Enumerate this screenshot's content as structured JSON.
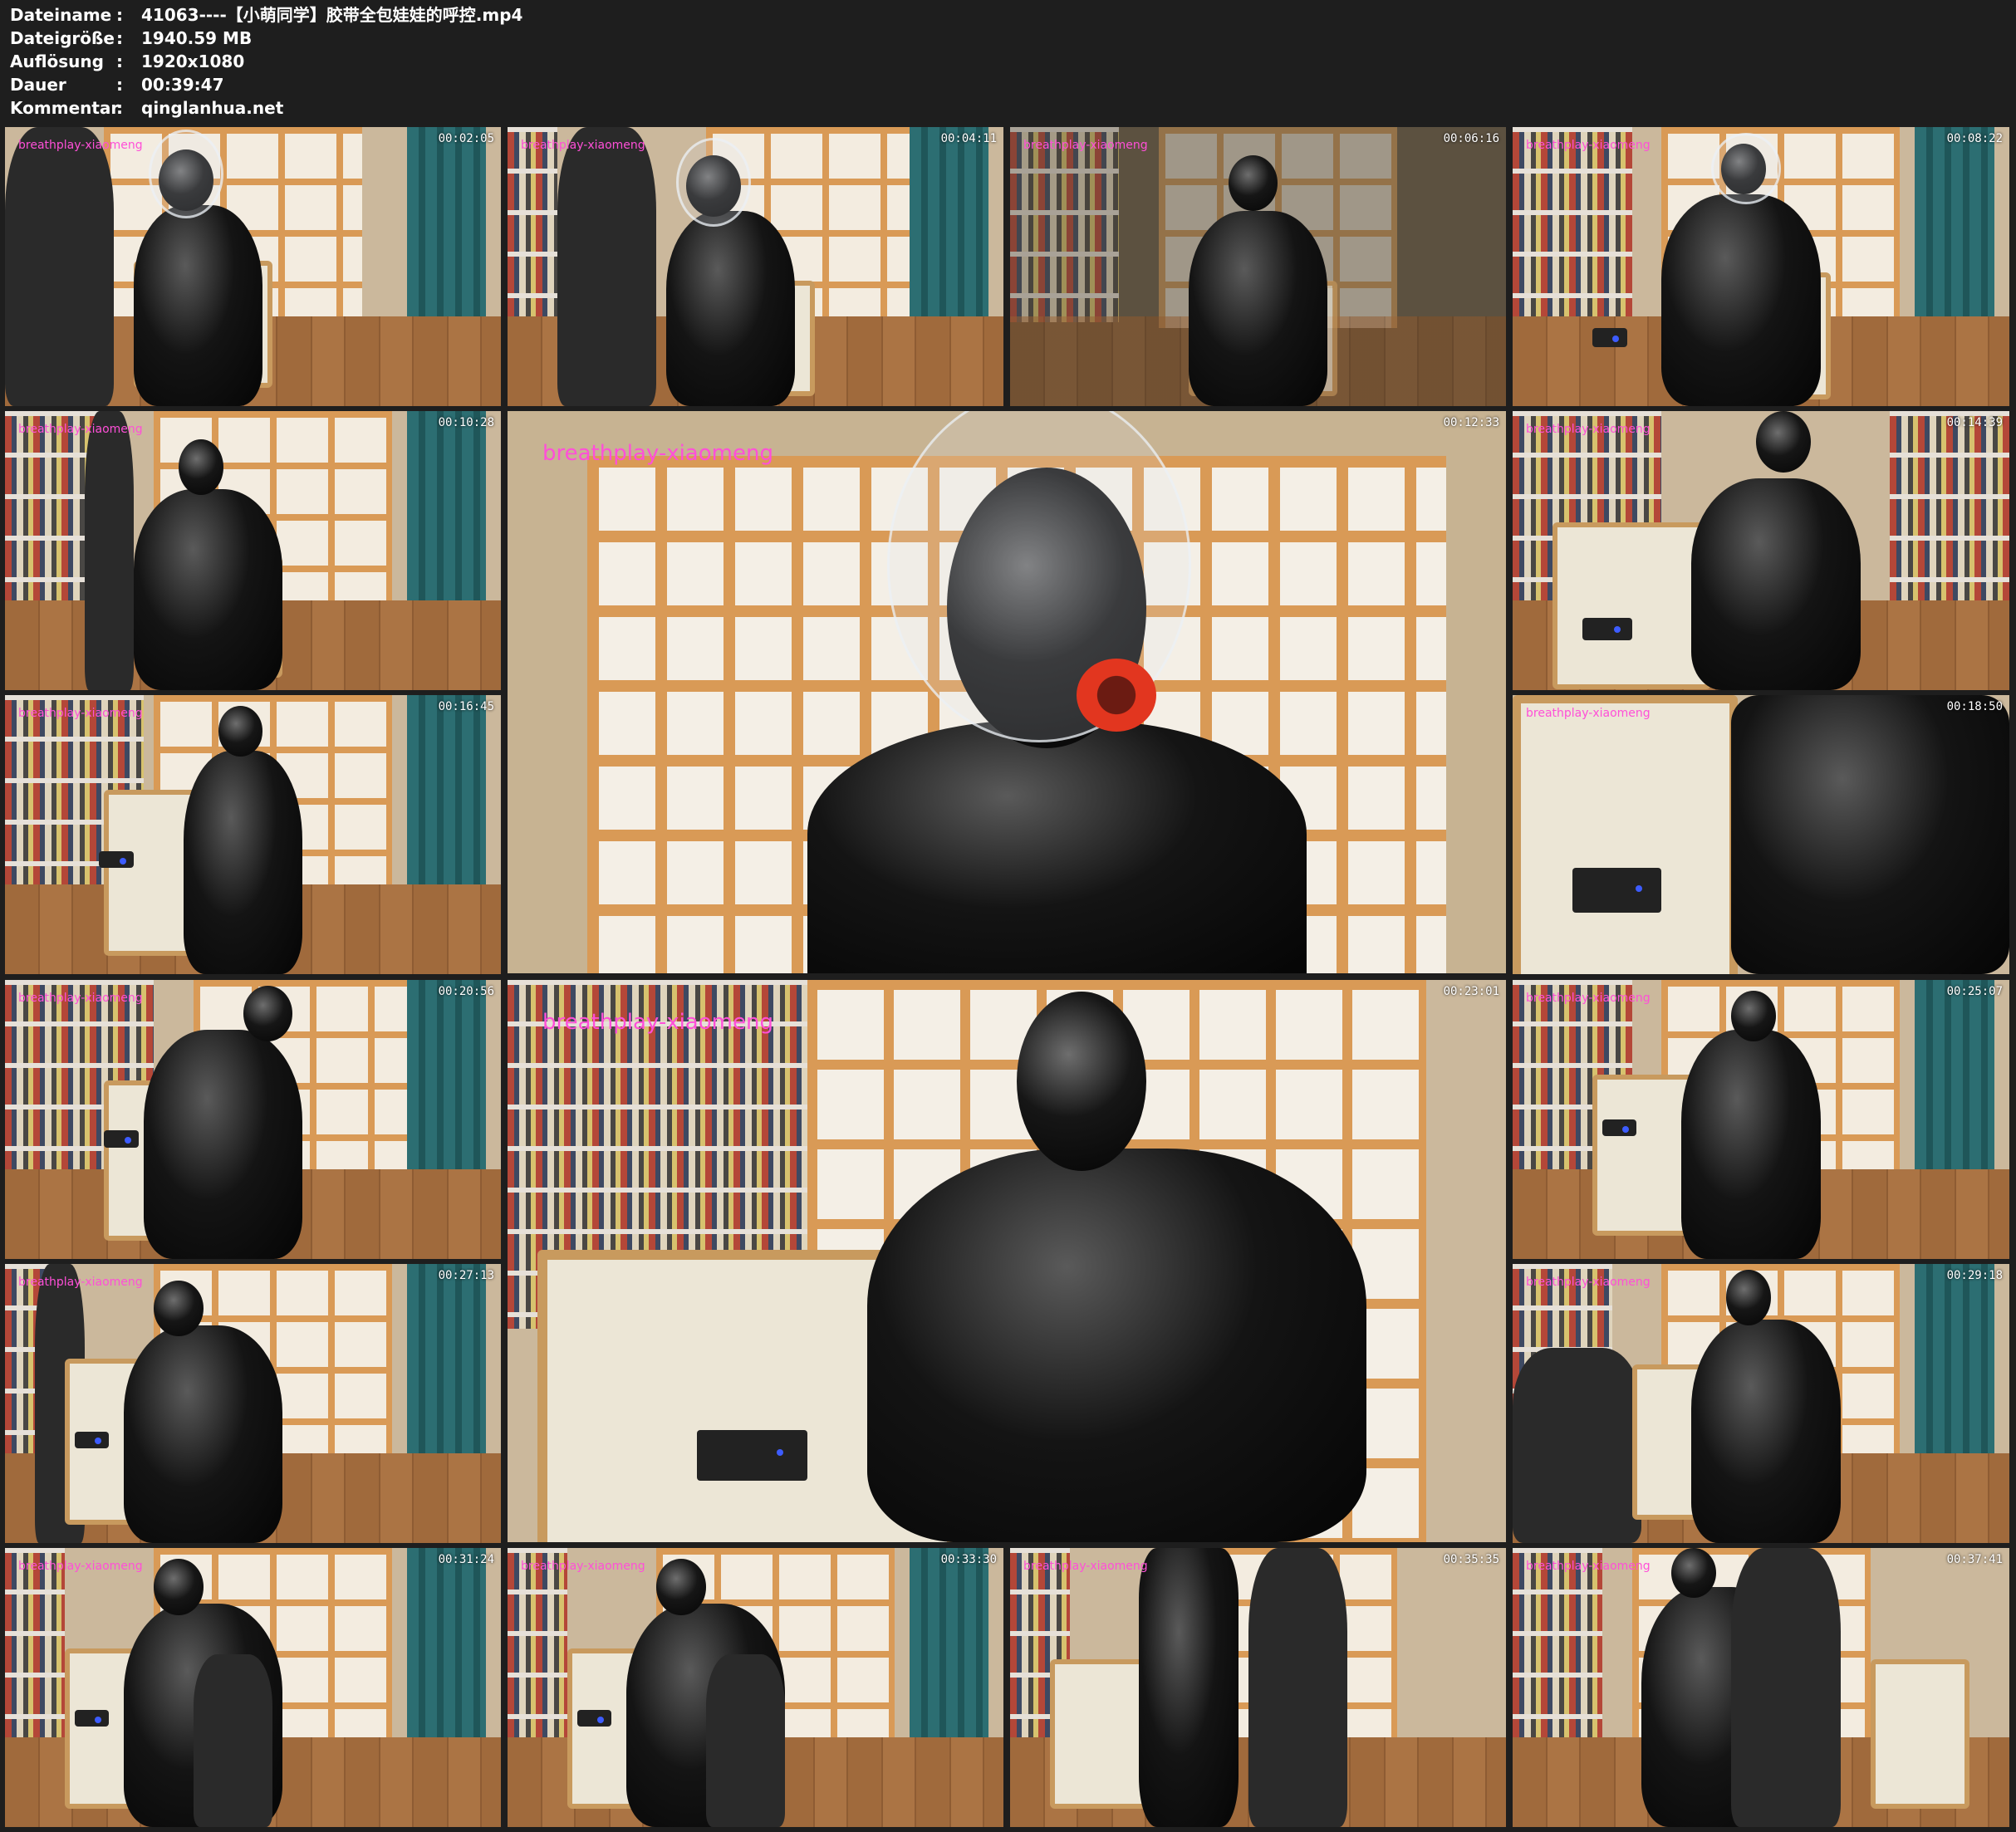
{
  "info": {
    "rows": [
      {
        "label": "Dateiname",
        "value": "41063----【小萌同学】胶带全包娃娃的呼控.mp4"
      },
      {
        "label": "Dateigröße",
        "value": "1940.59 MB"
      },
      {
        "label": "Auflösung",
        "value": "1920x1080"
      },
      {
        "label": "Dauer",
        "value": "00:39:47"
      },
      {
        "label": "Kommentar",
        "value": "qinglanhua.net"
      }
    ],
    "separator": ":"
  },
  "watermark": "breathplay-xiaomeng",
  "thumbnails": [
    {
      "time": "00:02:05"
    },
    {
      "time": "00:04:11"
    },
    {
      "time": "00:06:16"
    },
    {
      "time": "00:08:22"
    },
    {
      "time": "00:10:28"
    },
    {
      "time": "00:12:33"
    },
    {
      "time": "00:14:39"
    },
    {
      "time": "00:16:45"
    },
    {
      "time": "00:18:50"
    },
    {
      "time": "00:20:56"
    },
    {
      "time": "00:23:01"
    },
    {
      "time": "00:25:07"
    },
    {
      "time": "00:27:13"
    },
    {
      "time": "00:29:18"
    },
    {
      "time": "00:31:24"
    },
    {
      "time": "00:33:30"
    },
    {
      "time": "00:35:35"
    },
    {
      "time": "00:37:41"
    }
  ],
  "colors": {
    "background": "#1e1e1e",
    "header_text": "#ffffff",
    "watermark": "#ff4fd8",
    "timestamp": "#ffffff"
  }
}
